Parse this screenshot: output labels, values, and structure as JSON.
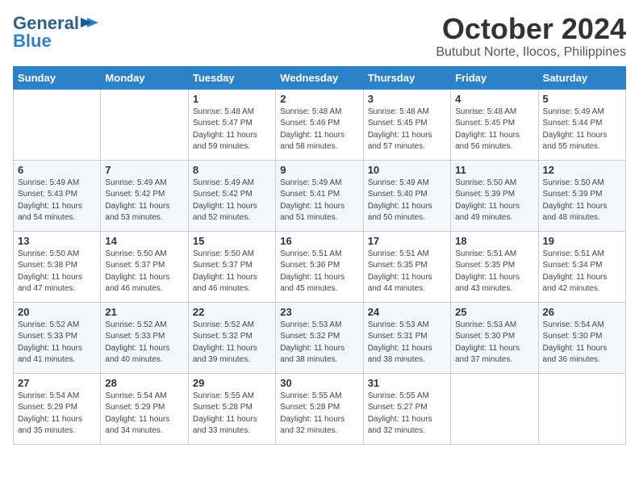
{
  "header": {
    "logo_line1": "General",
    "logo_line2": "Blue",
    "month": "October 2024",
    "location": "Butubut Norte, Ilocos, Philippines"
  },
  "weekdays": [
    "Sunday",
    "Monday",
    "Tuesday",
    "Wednesday",
    "Thursday",
    "Friday",
    "Saturday"
  ],
  "weeks": [
    [
      {
        "day": "",
        "info": ""
      },
      {
        "day": "",
        "info": ""
      },
      {
        "day": "1",
        "info": "Sunrise: 5:48 AM\nSunset: 5:47 PM\nDaylight: 11 hours and 59 minutes."
      },
      {
        "day": "2",
        "info": "Sunrise: 5:48 AM\nSunset: 5:46 PM\nDaylight: 11 hours and 58 minutes."
      },
      {
        "day": "3",
        "info": "Sunrise: 5:48 AM\nSunset: 5:45 PM\nDaylight: 11 hours and 57 minutes."
      },
      {
        "day": "4",
        "info": "Sunrise: 5:48 AM\nSunset: 5:45 PM\nDaylight: 11 hours and 56 minutes."
      },
      {
        "day": "5",
        "info": "Sunrise: 5:49 AM\nSunset: 5:44 PM\nDaylight: 11 hours and 55 minutes."
      }
    ],
    [
      {
        "day": "6",
        "info": "Sunrise: 5:49 AM\nSunset: 5:43 PM\nDaylight: 11 hours and 54 minutes."
      },
      {
        "day": "7",
        "info": "Sunrise: 5:49 AM\nSunset: 5:42 PM\nDaylight: 11 hours and 53 minutes."
      },
      {
        "day": "8",
        "info": "Sunrise: 5:49 AM\nSunset: 5:42 PM\nDaylight: 11 hours and 52 minutes."
      },
      {
        "day": "9",
        "info": "Sunrise: 5:49 AM\nSunset: 5:41 PM\nDaylight: 11 hours and 51 minutes."
      },
      {
        "day": "10",
        "info": "Sunrise: 5:49 AM\nSunset: 5:40 PM\nDaylight: 11 hours and 50 minutes."
      },
      {
        "day": "11",
        "info": "Sunrise: 5:50 AM\nSunset: 5:39 PM\nDaylight: 11 hours and 49 minutes."
      },
      {
        "day": "12",
        "info": "Sunrise: 5:50 AM\nSunset: 5:39 PM\nDaylight: 11 hours and 48 minutes."
      }
    ],
    [
      {
        "day": "13",
        "info": "Sunrise: 5:50 AM\nSunset: 5:38 PM\nDaylight: 11 hours and 47 minutes."
      },
      {
        "day": "14",
        "info": "Sunrise: 5:50 AM\nSunset: 5:37 PM\nDaylight: 11 hours and 46 minutes."
      },
      {
        "day": "15",
        "info": "Sunrise: 5:50 AM\nSunset: 5:37 PM\nDaylight: 11 hours and 46 minutes."
      },
      {
        "day": "16",
        "info": "Sunrise: 5:51 AM\nSunset: 5:36 PM\nDaylight: 11 hours and 45 minutes."
      },
      {
        "day": "17",
        "info": "Sunrise: 5:51 AM\nSunset: 5:35 PM\nDaylight: 11 hours and 44 minutes."
      },
      {
        "day": "18",
        "info": "Sunrise: 5:51 AM\nSunset: 5:35 PM\nDaylight: 11 hours and 43 minutes."
      },
      {
        "day": "19",
        "info": "Sunrise: 5:51 AM\nSunset: 5:34 PM\nDaylight: 11 hours and 42 minutes."
      }
    ],
    [
      {
        "day": "20",
        "info": "Sunrise: 5:52 AM\nSunset: 5:33 PM\nDaylight: 11 hours and 41 minutes."
      },
      {
        "day": "21",
        "info": "Sunrise: 5:52 AM\nSunset: 5:33 PM\nDaylight: 11 hours and 40 minutes."
      },
      {
        "day": "22",
        "info": "Sunrise: 5:52 AM\nSunset: 5:32 PM\nDaylight: 11 hours and 39 minutes."
      },
      {
        "day": "23",
        "info": "Sunrise: 5:53 AM\nSunset: 5:32 PM\nDaylight: 11 hours and 38 minutes."
      },
      {
        "day": "24",
        "info": "Sunrise: 5:53 AM\nSunset: 5:31 PM\nDaylight: 11 hours and 38 minutes."
      },
      {
        "day": "25",
        "info": "Sunrise: 5:53 AM\nSunset: 5:30 PM\nDaylight: 11 hours and 37 minutes."
      },
      {
        "day": "26",
        "info": "Sunrise: 5:54 AM\nSunset: 5:30 PM\nDaylight: 11 hours and 36 minutes."
      }
    ],
    [
      {
        "day": "27",
        "info": "Sunrise: 5:54 AM\nSunset: 5:29 PM\nDaylight: 11 hours and 35 minutes."
      },
      {
        "day": "28",
        "info": "Sunrise: 5:54 AM\nSunset: 5:29 PM\nDaylight: 11 hours and 34 minutes."
      },
      {
        "day": "29",
        "info": "Sunrise: 5:55 AM\nSunset: 5:28 PM\nDaylight: 11 hours and 33 minutes."
      },
      {
        "day": "30",
        "info": "Sunrise: 5:55 AM\nSunset: 5:28 PM\nDaylight: 11 hours and 32 minutes."
      },
      {
        "day": "31",
        "info": "Sunrise: 5:55 AM\nSunset: 5:27 PM\nDaylight: 11 hours and 32 minutes."
      },
      {
        "day": "",
        "info": ""
      },
      {
        "day": "",
        "info": ""
      }
    ]
  ]
}
